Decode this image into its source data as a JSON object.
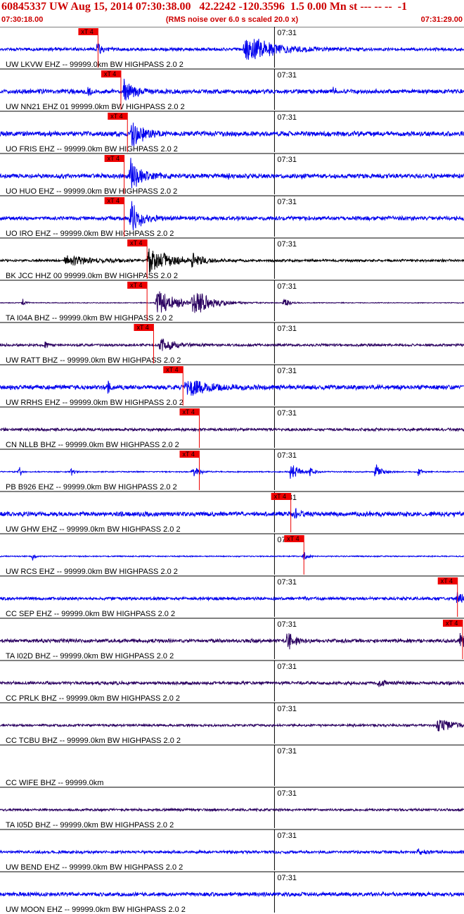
{
  "header": {
    "title": "60845337 UW Aug 15, 2014 07:30:38.00   42.2242 -120.3596  1.5 0.00 Mn st --- -- --  -1",
    "start_time": "07:30:18.00",
    "subtitle": "(RMS noise over 6.0 s scaled 20.0 x)",
    "end_time": "07:31:29.00"
  },
  "chart_data": {
    "type": "line",
    "title": "60845337 UW Aug 15, 2014 07:30:38.00   42.2242 -120.3596  1.5 0.00 Mn st --- -- --  -1",
    "x_axis": {
      "start": "07:30:18.00",
      "end": "07:31:29.00",
      "unit": "s",
      "range": [
        0,
        71
      ],
      "minute_mark_label": "07:31",
      "minute_mark_at": 42
    },
    "pick_label": "xT 4",
    "colors": {
      "blue_trace": "#0000ee",
      "dark_trace": "#000000",
      "purple_trace": "#2a0060",
      "pick": "#ee0000",
      "grid": "#000000"
    },
    "series": [
      {
        "name": "UW LKVW EHZ -- 99999.0km BW  HIGHPASS  2.0  2",
        "color": "#0000ee",
        "pick_s": 15.0,
        "noise": 0.16,
        "events": [
          [
            15.0,
            0.9,
            0.4
          ],
          [
            37.5,
            1.4,
            4.0
          ]
        ]
      },
      {
        "name": "UW NN21 EHZ 01 99999.0km BW  HIGHPASS  2.0  2",
        "color": "#0000ee",
        "pick_s": 18.5,
        "noise": 0.22,
        "events": [
          [
            19.0,
            1.1,
            1.5
          ],
          [
            13.5,
            0.5,
            0.3
          ],
          [
            51.0,
            0.4,
            0.3
          ]
        ]
      },
      {
        "name": "UO FRIS EHZ -- 99999.0km BW  HIGHPASS  2.0  2",
        "color": "#0000ee",
        "pick_s": 19.5,
        "noise": 0.25,
        "events": [
          [
            20.2,
            1.6,
            1.4
          ]
        ]
      },
      {
        "name": "UO HUO EHZ -- 99999.0km BW  HIGHPASS  2.0  2",
        "color": "#0000ee",
        "pick_s": 19.0,
        "noise": 0.23,
        "events": [
          [
            20.0,
            1.5,
            1.6
          ],
          [
            35.0,
            0.4,
            0.2
          ]
        ]
      },
      {
        "name": "UO IRO EHZ -- 99999.0km BW  HIGHPASS  2.0  2",
        "color": "#0000ee",
        "pick_s": 19.0,
        "noise": 0.2,
        "events": [
          [
            20.0,
            1.6,
            1.5
          ]
        ]
      },
      {
        "name": "BK JCC HHZ 00 99999.0km BW  HIGHPASS  2.0  2",
        "color": "#000000",
        "pick_s": 22.5,
        "noise": 0.12,
        "events": [
          [
            10.0,
            0.5,
            4.0
          ],
          [
            22.8,
            1.3,
            3.0
          ],
          [
            29.5,
            0.8,
            1.0
          ]
        ]
      },
      {
        "name": "TA I04A BHZ -- 99999.0km BW  HIGHPASS  2.0  2",
        "color": "#2a0060",
        "pick_s": 22.5,
        "noise": 0.04,
        "events": [
          [
            3.5,
            0.35,
            0.4
          ],
          [
            24.0,
            1.5,
            2.8
          ],
          [
            29.5,
            1.4,
            2.5
          ],
          [
            43.5,
            0.6,
            0.7
          ]
        ]
      },
      {
        "name": "UW RATT BHZ -- 99999.0km BW  HIGHPASS  2.0  2",
        "color": "#2a0060",
        "pick_s": 23.5,
        "noise": 0.12,
        "events": [
          [
            24.5,
            0.7,
            2.0
          ],
          [
            7.0,
            0.3,
            0.4
          ]
        ]
      },
      {
        "name": "UW RRHS EHZ -- 99999.0km BW  HIGHPASS  2.0  2",
        "color": "#0000ee",
        "pick_s": 28.0,
        "noise": 0.22,
        "events": [
          [
            28.5,
            0.9,
            3.5
          ],
          [
            16.5,
            0.7,
            0.3
          ]
        ]
      },
      {
        "name": "CN NLLB BHZ -- 99999.0km BW  HIGHPASS  2.0  2",
        "color": "#2a0060",
        "pick_s": 30.5,
        "noise": 0.14,
        "events": []
      },
      {
        "name": "PB B926 EHZ -- 99999.0km BW  HIGHPASS  2.0  2",
        "color": "#0000ee",
        "pick_s": 30.5,
        "noise": 0.06,
        "events": [
          [
            3.0,
            0.45,
            0.3
          ],
          [
            11.0,
            0.6,
            0.3
          ],
          [
            29.5,
            0.8,
            0.8
          ],
          [
            44.5,
            0.9,
            1.0
          ],
          [
            47.5,
            0.6,
            0.5
          ],
          [
            57.5,
            0.9,
            0.8
          ],
          [
            64.0,
            0.4,
            0.5
          ]
        ]
      },
      {
        "name": "UW GHW EHZ -- 99999.0km BW  HIGHPASS  2.0  2",
        "color": "#0000ee",
        "pick_s": 44.5,
        "noise": 0.23,
        "events": [
          [
            45.0,
            0.5,
            1.0
          ]
        ]
      },
      {
        "name": "UW RCS EHZ -- 99999.0km BW  HIGHPASS  2.0  2",
        "color": "#0000ee",
        "pick_s": 46.5,
        "noise": 0.06,
        "events": [
          [
            5.0,
            0.35,
            0.3
          ],
          [
            46.5,
            0.5,
            0.5
          ]
        ]
      },
      {
        "name": "CC SEP EHZ -- 99999.0km BW  HIGHPASS  2.0  2",
        "color": "#0000ee",
        "pick_s": 70.0,
        "noise": 0.15,
        "events": [
          [
            70.0,
            0.6,
            1.0
          ]
        ]
      },
      {
        "name": "TA I02D BHZ -- 99999.0km BW  HIGHPASS  2.0  2",
        "color": "#2a0060",
        "pick_s": 71.0,
        "noise": 0.18,
        "events": [
          [
            44.0,
            0.8,
            1.2
          ],
          [
            70.5,
            0.8,
            0.8
          ]
        ]
      },
      {
        "name": "CC PRLK BHZ -- 99999.0km BW  HIGHPASS  2.0  2",
        "color": "#2a0060",
        "pick_s": null,
        "noise": 0.16,
        "events": [
          [
            58.0,
            0.3,
            1.0
          ]
        ]
      },
      {
        "name": "CC TCBU BHZ -- 99999.0km BW  HIGHPASS  2.0  2",
        "color": "#2a0060",
        "pick_s": null,
        "noise": 0.12,
        "events": [
          [
            67.0,
            0.6,
            2.5
          ]
        ]
      },
      {
        "name": "CC WIFE BHZ -- 99999.0km",
        "color": "#2a0060",
        "pick_s": null,
        "noise": 0.0,
        "events": []
      },
      {
        "name": "TA I05D BHZ -- 99999.0km BW  HIGHPASS  2.0  2",
        "color": "#2a0060",
        "pick_s": null,
        "noise": 0.12,
        "events": []
      },
      {
        "name": "UW BEND EHZ -- 99999.0km BW  HIGHPASS  2.0  2",
        "color": "#0000ee",
        "pick_s": null,
        "noise": 0.14,
        "events": [
          [
            64.0,
            0.25,
            1.0
          ]
        ]
      },
      {
        "name": "UW MOON EHZ -- 99999.0km BW  HIGHPASS  2.0  2",
        "color": "#0000ee",
        "pick_s": null,
        "noise": 0.2,
        "events": []
      }
    ]
  }
}
